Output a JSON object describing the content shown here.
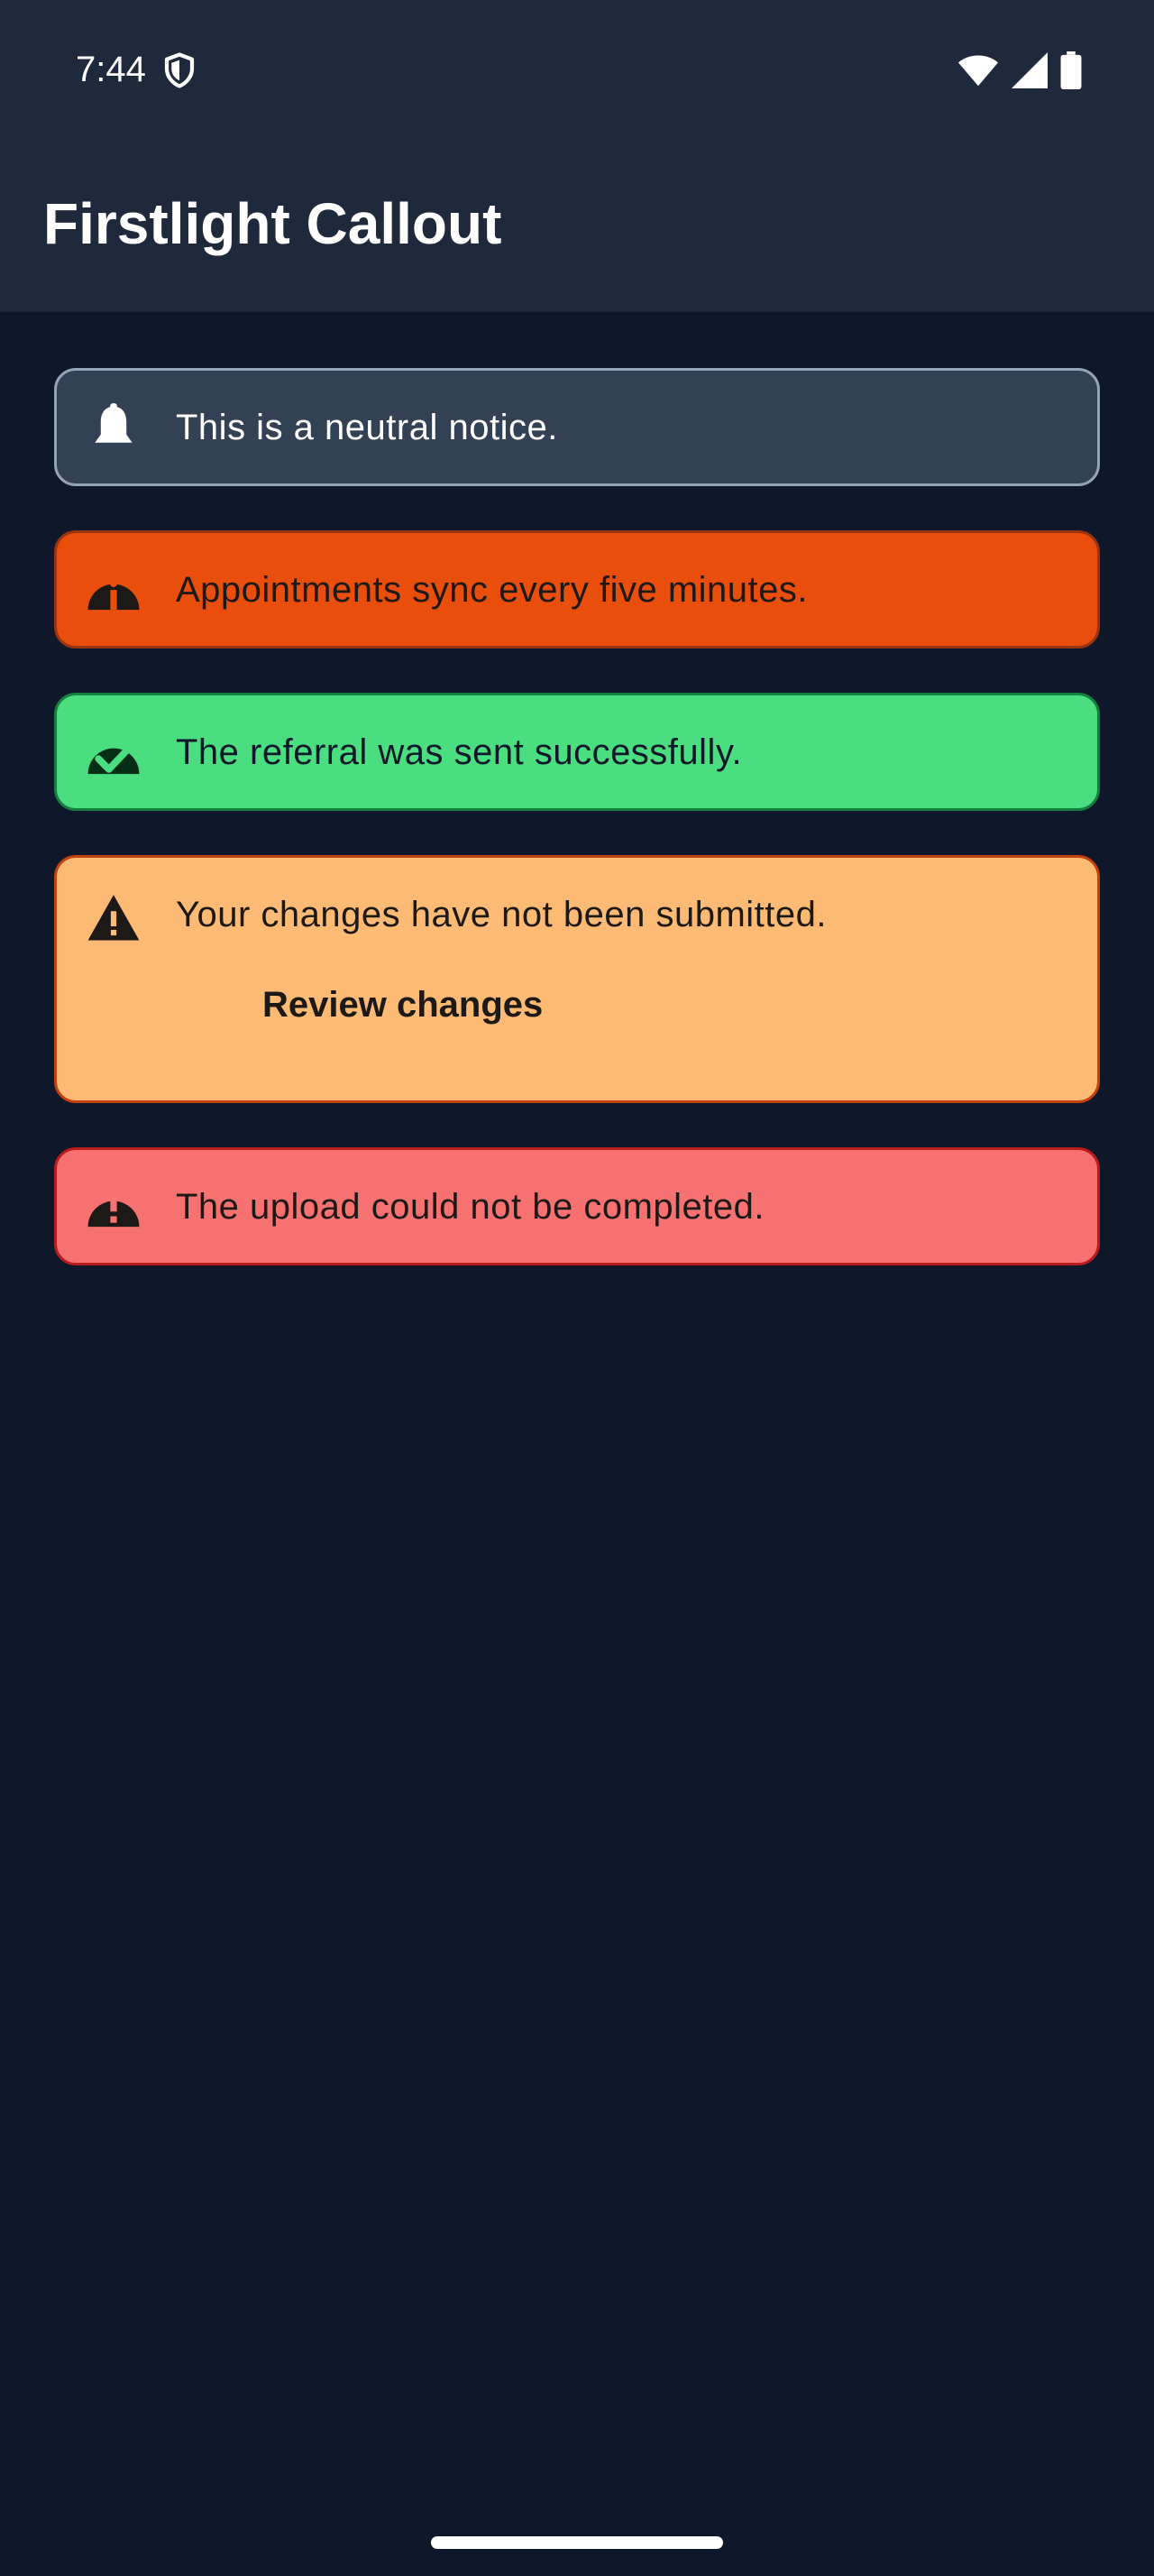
{
  "status_bar": {
    "time": "7:44",
    "icons": [
      "shield-icon",
      "wifi-icon",
      "cellular-signal-icon",
      "battery-icon"
    ]
  },
  "app_bar": {
    "title": "Firstlight Callout"
  },
  "callouts": [
    {
      "variant": "neutral",
      "icon": "bell-icon",
      "message": "This is a neutral notice.",
      "background": "#334155",
      "border": "#94a3b8",
      "text_color": "#ffffff"
    },
    {
      "variant": "info",
      "icon": "info-icon",
      "message": "Appointments sync every five minutes.",
      "background": "#ea4e0c",
      "border": "#9a3412",
      "text_color": "#1c1917"
    },
    {
      "variant": "success",
      "icon": "check-circle-icon",
      "message": "The referral was sent successfully.",
      "background": "#4ade80",
      "border": "#15803d",
      "text_color": "#0f172a"
    },
    {
      "variant": "warning",
      "icon": "warning-triangle-icon",
      "message": "Your changes have not been submitted.",
      "action_label": "Review changes",
      "background": "#fdba74",
      "border": "#c2410c",
      "text_color": "#1c1917"
    },
    {
      "variant": "error",
      "icon": "error-icon",
      "message": "The upload could not be completed.",
      "background": "#f87171",
      "border": "#b91c1c",
      "text_color": "#1c1917"
    }
  ],
  "colors": {
    "page_background": "#0f172a",
    "app_bar_background": "#1e293b",
    "app_bar_text": "#ffffff"
  }
}
